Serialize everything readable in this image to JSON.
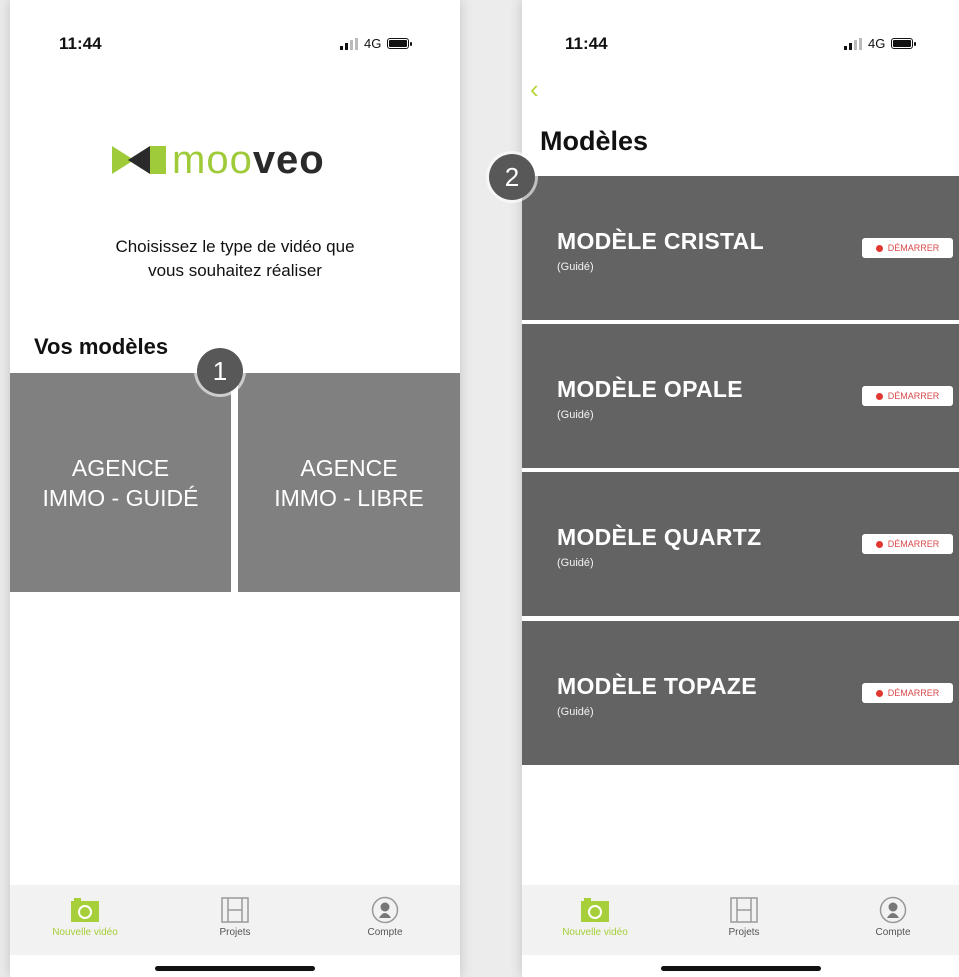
{
  "phone1": {
    "status": {
      "time": "11:44",
      "network": "4G"
    },
    "logo": {
      "text_light": "moo",
      "text_bold": "veo"
    },
    "subtitle_line1": "Choisissez le type de vidéo que",
    "subtitle_line2": "vous souhaitez réaliser",
    "section_title": "Vos modèles",
    "marker": "1",
    "tiles": [
      {
        "line1": "AGENCE",
        "line2": "IMMO - GUIDÉ"
      },
      {
        "line1": "AGENCE",
        "line2": "IMMO - LIBRE"
      }
    ]
  },
  "phone2": {
    "status": {
      "time": "11:44",
      "network": "4G"
    },
    "back_icon": "chevron-left-icon",
    "page_title": "Modèles",
    "marker": "2",
    "start_label": "DÉMARRER",
    "models": [
      {
        "name": "MODÈLE CRISTAL",
        "sub": "(Guidé)"
      },
      {
        "name": "MODÈLE OPALE",
        "sub": "(Guidé)"
      },
      {
        "name": "MODÈLE QUARTZ",
        "sub": "(Guidé)"
      },
      {
        "name": "MODÈLE TOPAZE",
        "sub": "(Guidé)"
      }
    ]
  },
  "tabbar": {
    "items": [
      {
        "label": "Nouvelle vidéo",
        "icon": "camera-icon",
        "active": true
      },
      {
        "label": "Projets",
        "icon": "film-icon",
        "active": false
      },
      {
        "label": "Compte",
        "icon": "account-icon",
        "active": false
      }
    ]
  },
  "colors": {
    "accent": "#a6cf3a",
    "tile_gray": "#808080",
    "row_gray": "#636363",
    "record_red": "#e2372f"
  }
}
